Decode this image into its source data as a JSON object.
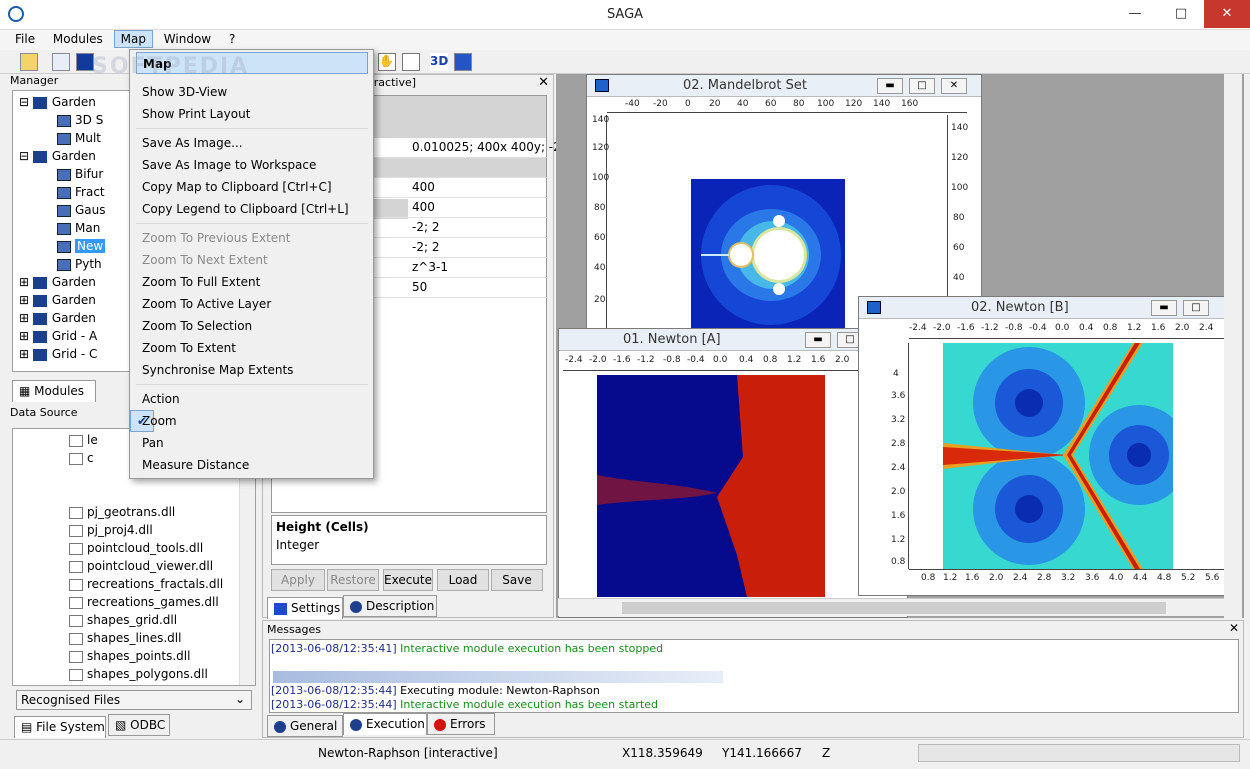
{
  "app": {
    "title": "SAGA"
  },
  "menubar": [
    "File",
    "Modules",
    "Map",
    "Window",
    "?"
  ],
  "manager": {
    "title": "Manager",
    "tree": [
      {
        "label": "Garden"
      },
      {
        "label": "3D S"
      },
      {
        "label": "Mult"
      },
      {
        "label": "Garden"
      },
      {
        "label": "Bifur"
      },
      {
        "label": "Fract"
      },
      {
        "label": "Gaus"
      },
      {
        "label": "Man"
      },
      {
        "label": "New"
      },
      {
        "label": "Pyth"
      },
      {
        "label": "Garden"
      },
      {
        "label": "Garden"
      },
      {
        "label": "Garden"
      },
      {
        "label": "Grid - A"
      },
      {
        "label": "Grid - C"
      }
    ],
    "tab_label": "Modules"
  },
  "data_source": {
    "title": "Data Source",
    "files": [
      "le",
      "c",
      "pj_geotrans.dll",
      "pj_proj4.dll",
      "pointcloud_tools.dll",
      "pointcloud_viewer.dll",
      "recreations_fractals.dll",
      "recreations_games.dll",
      "shapes_grid.dll",
      "shapes_lines.dll",
      "shapes_points.dll",
      "shapes_polygons.dll"
    ],
    "combo": "Recognised Files",
    "tabs": [
      "File System",
      "ODBC"
    ]
  },
  "settings": {
    "header_suffix": "eractive]",
    "rows": [
      {
        "value": "0.010025; 400x 400y; -2x -"
      },
      {
        "value": ""
      },
      {
        "value": "400"
      },
      {
        "value": "400"
      },
      {
        "value": "-2; 2"
      },
      {
        "value": "-2; 2"
      },
      {
        "value": "z^3-1"
      },
      {
        "value": "50"
      }
    ],
    "desc_title": "Height (Cells)",
    "desc_type": "Integer",
    "buttons": [
      "Apply",
      "Restore",
      "Execute",
      "Load",
      "Save"
    ],
    "tabs": [
      "Settings",
      "Description"
    ]
  },
  "menu": {
    "items": [
      {
        "label": "Map",
        "state": "highlight"
      },
      {
        "label": "Show 3D-View",
        "state": "normal"
      },
      {
        "label": "Show Print Layout",
        "state": "normal"
      },
      {
        "label": "Save As Image...",
        "state": "normal"
      },
      {
        "label": "Save As Image to Workspace",
        "state": "normal"
      },
      {
        "label": "Copy Map to Clipboard [Ctrl+C]",
        "state": "normal"
      },
      {
        "label": "Copy Legend to Clipboard [Ctrl+L]",
        "state": "normal"
      },
      {
        "label": "Zoom To Previous Extent",
        "state": "disabled"
      },
      {
        "label": "Zoom To Next Extent",
        "state": "disabled"
      },
      {
        "label": "Zoom To Full Extent",
        "state": "normal"
      },
      {
        "label": "Zoom To Active Layer",
        "state": "normal"
      },
      {
        "label": "Zoom To Selection",
        "state": "normal"
      },
      {
        "label": "Zoom To Extent",
        "state": "normal"
      },
      {
        "label": "Synchronise Map Extents",
        "state": "normal"
      },
      {
        "label": "Action",
        "state": "normal"
      },
      {
        "label": "Zoom",
        "state": "checked"
      },
      {
        "label": "Pan",
        "state": "normal"
      },
      {
        "label": "Measure Distance",
        "state": "normal"
      }
    ]
  },
  "maps": {
    "mandelbrot": {
      "title": "02. Mandelbrot Set",
      "x_ticks": [
        "-40",
        "-20",
        "0",
        "20",
        "40",
        "60",
        "80",
        "100",
        "120",
        "140",
        "160"
      ],
      "y_ticks": [
        "140",
        "120",
        "100",
        "80",
        "60",
        "40",
        "20"
      ]
    },
    "newton_a": {
      "title": "01. Newton [A]",
      "x_ticks": [
        "-2.4",
        "-2.0",
        "-1.6",
        "-1.2",
        "-0.8",
        "-0.4",
        "0.0",
        "0.4",
        "0.8",
        "1.2",
        "1.6",
        "2.0"
      ]
    },
    "newton_b": {
      "title": "02. Newton [B]",
      "x_ticks": [
        "-2.4",
        "-2.0",
        "-1.6",
        "-1.2",
        "-0.8",
        "-0.4",
        "0.0",
        "0.4",
        "0.8",
        "1.2",
        "1.6",
        "2.0",
        "2.4"
      ],
      "y_ticks": [
        "4",
        "3.6",
        "3.2",
        "2.8",
        "2.4",
        "2.0",
        "1.6",
        "1.2",
        "0.8"
      ],
      "bx_ticks": [
        "0.8",
        "1.2",
        "1.6",
        "2.0",
        "2.4",
        "2.8",
        "3.2",
        "3.6",
        "4.0",
        "4.4",
        "4.8",
        "5.2",
        "5.6"
      ]
    }
  },
  "messages": {
    "title": "Messages",
    "lines": [
      {
        "ts": "[2013-06-08/12:35:41]",
        "text": "Interactive module execution has been stopped",
        "green": true
      },
      {
        "ts": "[2013-06-08/12:35:44]",
        "text": "Executing module: Newton-Raphson",
        "green": false
      },
      {
        "ts": "[2013-06-08/12:35:44]",
        "text": "Interactive module execution has been started",
        "green": true
      }
    ],
    "tabs": [
      "General",
      "Execution",
      "Errors"
    ]
  },
  "statusbar": {
    "module": "Newton-Raphson [interactive]",
    "x": "X118.359649",
    "y": "Y141.166667",
    "z": "Z"
  },
  "watermark": "SOFTPEDIA"
}
